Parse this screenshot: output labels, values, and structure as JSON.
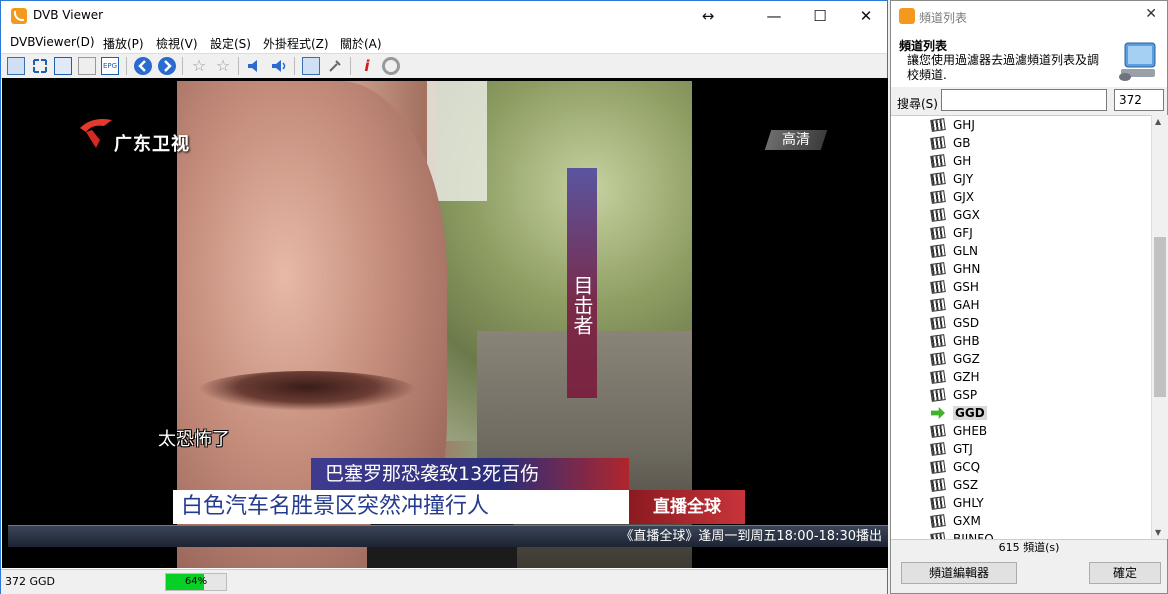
{
  "window": {
    "title": "DVB Viewer",
    "move_glyph": "↔",
    "minimize": "—",
    "maximize": "☐",
    "close": "✕"
  },
  "menu": [
    "DVBViewer(D)",
    "播放(P)",
    "檢視(V)",
    "設定(S)",
    "外掛程式(Z)",
    "關於(A)"
  ],
  "toolbar_icons": [
    "window-icon",
    "fullscreen-icon",
    "tv-icon",
    "osd-icon",
    "epg-icon",
    "back-icon",
    "forward-icon",
    "star-icon",
    "star-outline-icon",
    "volume-down-icon",
    "volume-up-icon",
    "copy-icon",
    "tools-icon",
    "info-icon",
    "record-icon"
  ],
  "video": {
    "channel_logo": "广东卫视",
    "hd_badge": "高清",
    "vertical_tag": "目击者",
    "subtitle": "太恐怖了",
    "headline1": "巴塞罗那恐袭致13死百伤",
    "headline2": "白色汽车名胜景区突然冲撞行人",
    "program_brand": "直播全球",
    "ticker": "《直播全球》逢周一到周五18:00-18:30播出"
  },
  "status": {
    "channel": "372 GGD",
    "signal_label": "64%",
    "signal_value": 0.64,
    "signal_color": "#06d025"
  },
  "panel": {
    "title": "頻道列表",
    "close": "✕",
    "heading": "頻道列表",
    "description": "讓您使用過濾器去過濾頻道列表及調校頻道.",
    "search_label": "搜尋(S)",
    "search_value": "",
    "number_value": "372",
    "channels": [
      {
        "name": "GHJ",
        "selected": false
      },
      {
        "name": "GB",
        "selected": false
      },
      {
        "name": "GH",
        "selected": false
      },
      {
        "name": "GJY",
        "selected": false
      },
      {
        "name": "GJX",
        "selected": false
      },
      {
        "name": "GGX",
        "selected": false
      },
      {
        "name": "GFJ",
        "selected": false
      },
      {
        "name": "GLN",
        "selected": false
      },
      {
        "name": "GHN",
        "selected": false
      },
      {
        "name": "GSH",
        "selected": false
      },
      {
        "name": "GAH",
        "selected": false
      },
      {
        "name": "GSD",
        "selected": false
      },
      {
        "name": "GHB",
        "selected": false
      },
      {
        "name": "GGZ",
        "selected": false
      },
      {
        "name": "GZH",
        "selected": false
      },
      {
        "name": "GSP",
        "selected": false
      },
      {
        "name": "GGD",
        "selected": true
      },
      {
        "name": "GHEB",
        "selected": false
      },
      {
        "name": "GTJ",
        "selected": false
      },
      {
        "name": "GCQ",
        "selected": false
      },
      {
        "name": "GSZ",
        "selected": false
      },
      {
        "name": "GHLY",
        "selected": false
      },
      {
        "name": "GXM",
        "selected": false
      },
      {
        "name": "BJINFO",
        "selected": false
      }
    ],
    "channel_count": "615 頻道(s)",
    "editor_button": "頻道編輯器",
    "ok_button": "確定"
  }
}
